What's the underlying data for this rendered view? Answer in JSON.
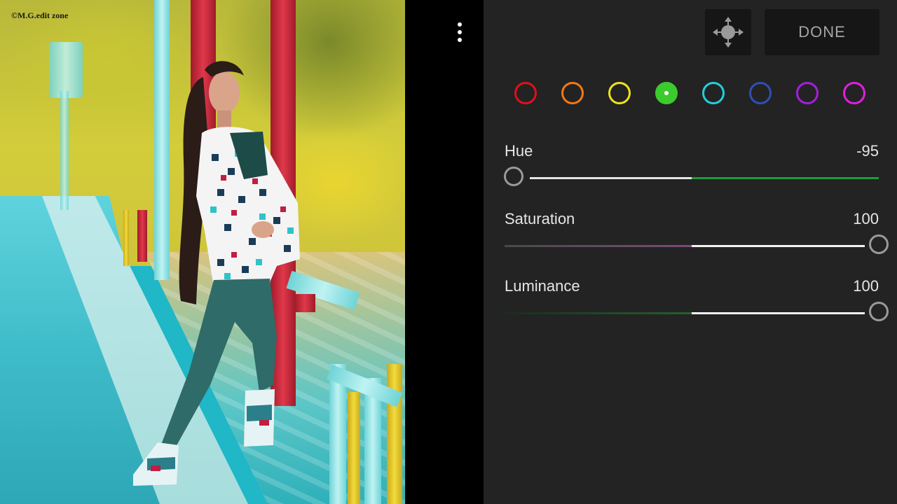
{
  "photo": {
    "watermark": "©M.G.edit zone"
  },
  "toolbar": {
    "menu_icon": "more-vertical-icon",
    "move_icon": "move-arrows-icon",
    "done_label": "DONE"
  },
  "color_mix": {
    "swatches": [
      {
        "name": "red",
        "color": "#e0101a"
      },
      {
        "name": "orange",
        "color": "#f07a12"
      },
      {
        "name": "yellow",
        "color": "#efe21b"
      },
      {
        "name": "green",
        "color": "#3ccb2c",
        "selected": true
      },
      {
        "name": "aqua",
        "color": "#1fd0dd"
      },
      {
        "name": "blue",
        "color": "#2f4fb3"
      },
      {
        "name": "purple",
        "color": "#a21fdc"
      },
      {
        "name": "magenta",
        "color": "#e01fe0"
      }
    ],
    "sliders": [
      {
        "label": "Hue",
        "value": "-95",
        "level": -95,
        "min": -100,
        "max": 100
      },
      {
        "label": "Saturation",
        "value": "100",
        "level": 100,
        "min": -100,
        "max": 100
      },
      {
        "label": "Luminance",
        "value": "100",
        "level": 100,
        "min": -100,
        "max": 100
      }
    ]
  }
}
